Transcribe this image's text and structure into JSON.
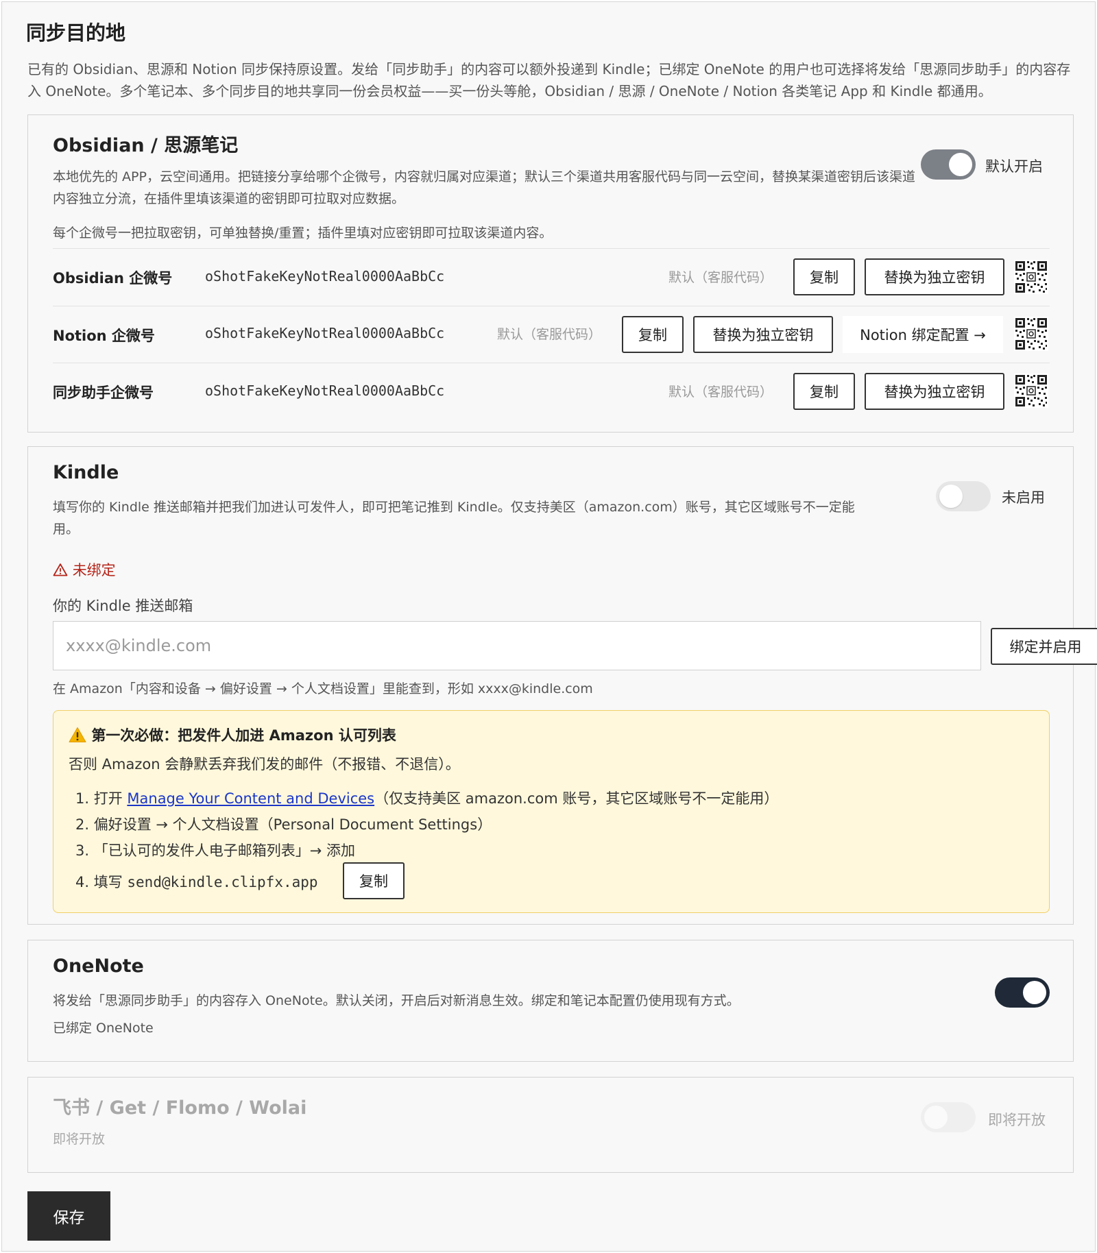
{
  "page": {
    "title": "同步目的地",
    "description": "已有的 Obsidian、思源和 Notion 同步保持原设置。发给「同步助手」的内容可以额外投递到 Kindle；已绑定 OneNote 的用户也可选择将发给「思源同步助手」的内容存入 OneNote。多个笔记本、多个同步目的地共享同一份会员权益——买一份头等舱，Obsidian / 思源 / OneNote / Notion 各类笔记 App 和 Kindle 都通用。"
  },
  "obsidian": {
    "title": "Obsidian / 思源笔记",
    "description": "本地优先的 APP，云空间通用。把链接分享给哪个企微号，内容就归属对应渠道；默认三个渠道共用客服代码与同一云空间，替换某渠道密钥后该渠道内容独立分流，在插件里填该渠道的密钥即可拉取对应数据。",
    "toggle_label": "默认开启",
    "note": "每个企微号一把拉取密钥，可单独替换/重置；插件里填对应密钥即可拉取该渠道内容。",
    "rows": [
      {
        "label": "Obsidian 企微号",
        "key": "oShotFakeKeyNotReal0000AaBbCc",
        "default_text": "默认（客服代码）",
        "copy_label": "复制",
        "replace_label": "替换为独立密钥"
      },
      {
        "label": "Notion 企微号",
        "key": "oShotFakeKeyNotReal0000AaBbCc",
        "default_text": "默认（客服代码）",
        "copy_label": "复制",
        "replace_label": "替换为独立密钥",
        "extra_label": "Notion 绑定配置 →"
      },
      {
        "label": "同步助手企微号",
        "key": "oShotFakeKeyNotReal0000AaBbCc",
        "default_text": "默认（客服代码）",
        "copy_label": "复制",
        "replace_label": "替换为独立密钥"
      }
    ]
  },
  "kindle": {
    "title": "Kindle",
    "description_line1": "填写你的 Kindle 推送邮箱并把我们加进认可发件人，即可把笔记推到 Kindle。仅支持美区（amazon.com）账号，其它区域账号不一定能",
    "description_line2": "用。",
    "toggle_label": "未启用",
    "status": "未绑定",
    "field_label": "你的 Kindle 推送邮箱",
    "email_value": "",
    "email_placeholder": "xxxx@kindle.com",
    "bind_label": "绑定并启用",
    "hint": "在 Amazon「内容和设备 → 偏好设置 → 个人文档设置」里能查到，形如 xxxx@kindle.com",
    "notice": {
      "title": "第一次必做：把发件人加进 Amazon 认可列表",
      "subtitle": "否则 Amazon 会静默丢弃我们发的邮件（不报错、不退信）。",
      "step1_prefix": "1. 打开 ",
      "step1_link": "Manage Your Content and Devices",
      "step1_suffix": "（仅支持美区 amazon.com 账号，其它区域账号不一定能用）",
      "step2": "2. 偏好设置 → 个人文档设置（Personal Document Settings）",
      "step3": "3. 「已认可的发件人电子邮箱列表」→ 添加",
      "step4_prefix": "4. 填写 ",
      "step4_email": "send@kindle.clipfx.app",
      "copy_label": "复制"
    }
  },
  "onenote": {
    "title": "OneNote",
    "description": "将发给「思源同步助手」的内容存入 OneNote。默认关闭，开启后对新消息生效。绑定和笔记本配置仍使用现有方式。",
    "status": "已绑定 OneNote"
  },
  "others": {
    "title": "飞书 / Get / Flomo / Wolai",
    "subtitle": "即将开放",
    "toggle_label": "即将开放"
  },
  "save_label": "保存",
  "colors": {
    "toggle_grey": "#7c8087",
    "toggle_dark": "#1f2937",
    "warning_red": "#b42318",
    "notice_bg": "#fff8dc",
    "link_blue": "#1a36c8",
    "save_bg": "#2b2b2b"
  },
  "icons": [
    "warning-icon",
    "alert-triangle-icon",
    "qr-code-icon"
  ]
}
